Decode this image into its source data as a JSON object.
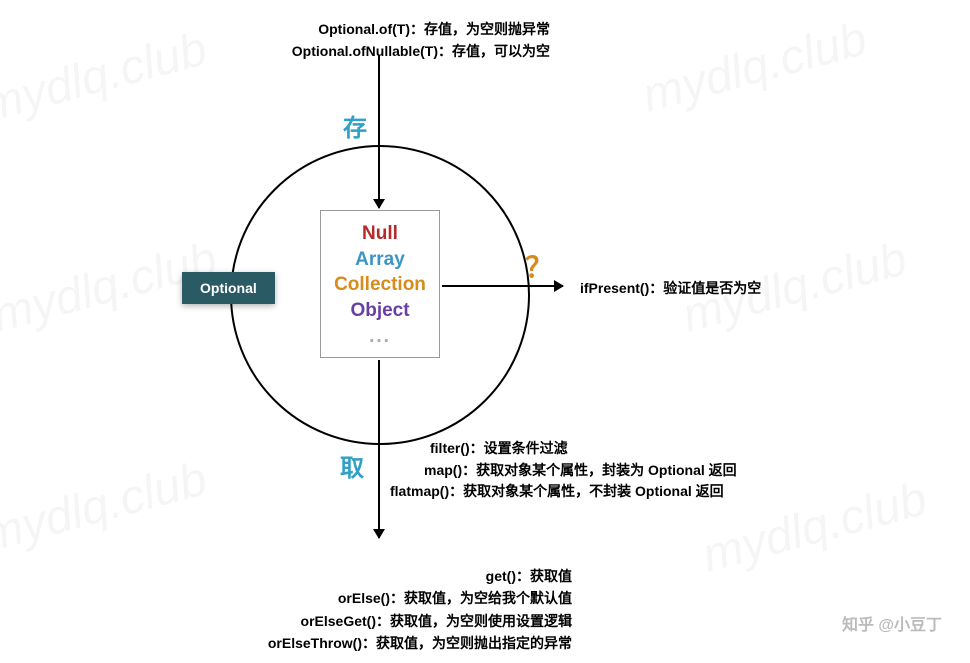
{
  "watermark": "mydlq.club",
  "top": {
    "of": {
      "method": "Optional.of(T)：",
      "desc": "存值，为空则抛异常"
    },
    "ofNullable": {
      "method": "Optional.ofNullable(T)：",
      "desc": "存值，可以为空"
    }
  },
  "labels": {
    "store": "存",
    "get": "取",
    "question": "？"
  },
  "badge": "Optional",
  "inner": {
    "null": "Null",
    "array": "Array",
    "collection": "Collection",
    "object": "Object",
    "dots": "..."
  },
  "right": {
    "method": "ifPresent()：",
    "desc": "验证值是否为空"
  },
  "mid": {
    "filter": {
      "method": "filter()：",
      "desc": "设置条件过滤"
    },
    "map": {
      "method": "map()：",
      "desc": "获取对象某个属性，封装为 Optional 返回"
    },
    "flatmap": {
      "method": "flatmap()：",
      "desc": "获取对象某个属性，不封装 Optional 返回"
    }
  },
  "bottom": {
    "get": {
      "method": "get()：",
      "desc": "获取值"
    },
    "orElse": {
      "method": "orElse()：",
      "desc": "获取值，为空给我个默认值"
    },
    "orElseGet": {
      "method": "orElseGet()：",
      "desc": "获取值，为空则使用设置逻辑"
    },
    "orElseThrow": {
      "method": "orElseThrow()：",
      "desc": "获取值，为空则抛出指定的异常"
    }
  },
  "zhihu": "知乎 @小豆丁"
}
